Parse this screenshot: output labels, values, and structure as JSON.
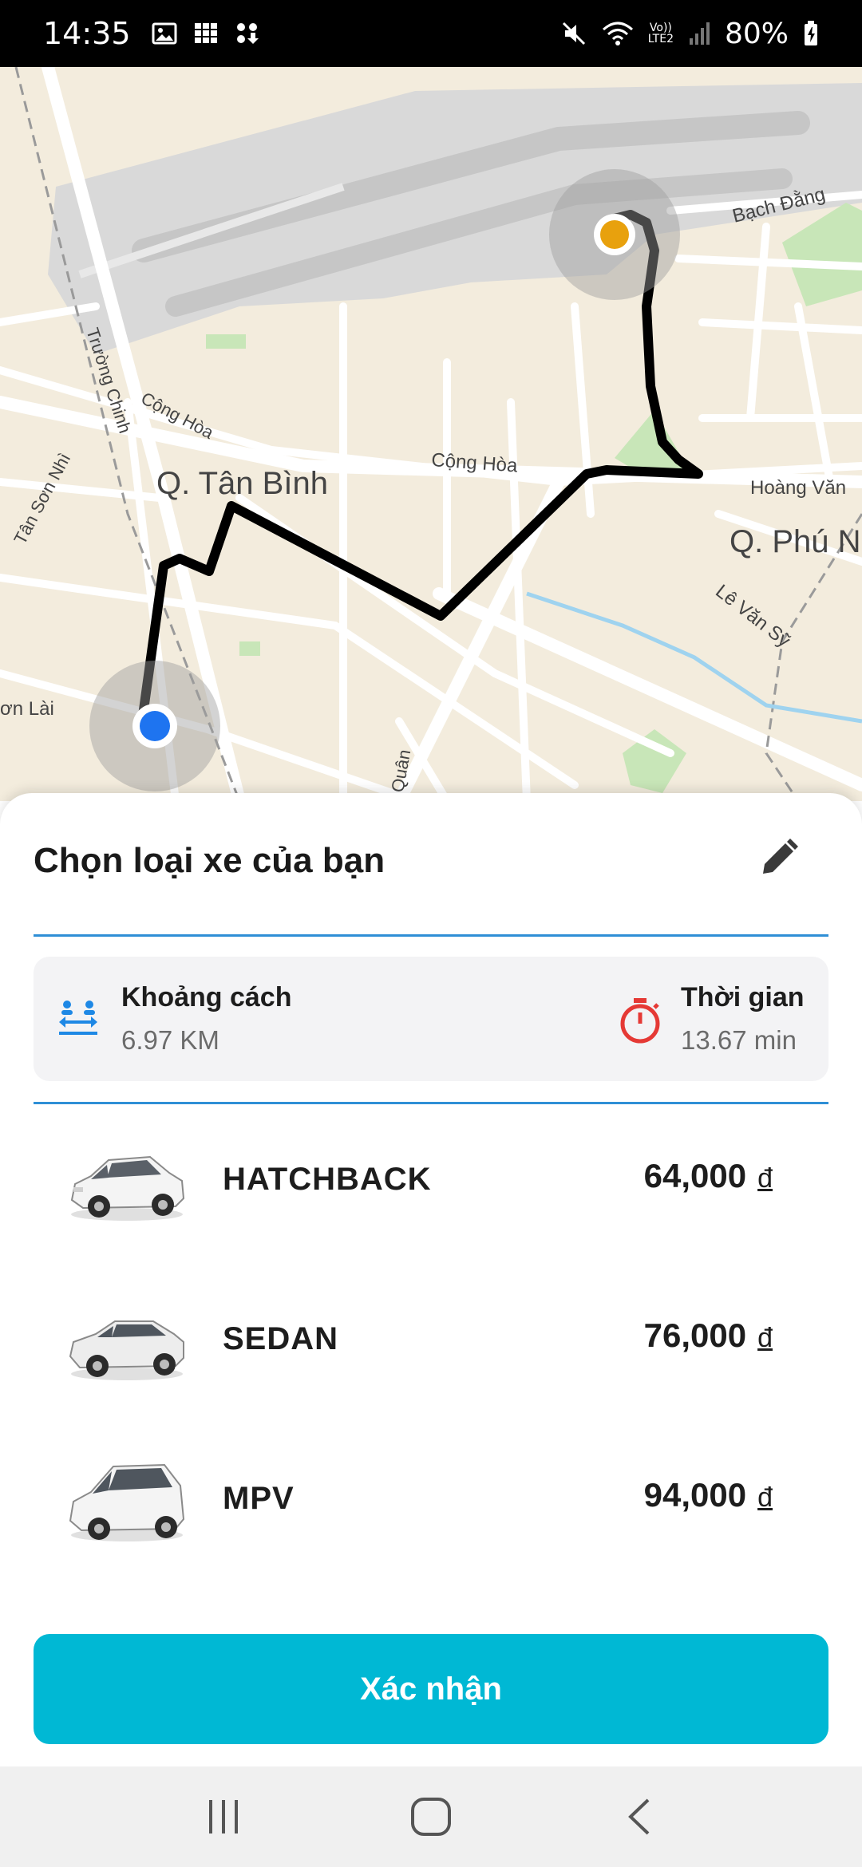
{
  "status_bar": {
    "time": "14:35",
    "battery": "80%",
    "network_top": "Vo))",
    "network_bottom": "LTE2",
    "icons": [
      "image-icon",
      "grid-icon",
      "download-icon",
      "mute-icon",
      "wifi-icon",
      "signal-icon",
      "battery-icon"
    ]
  },
  "map": {
    "labels": {
      "district_1": "Q. Tân Bình",
      "district_2": "Q. Phú N",
      "street_1": "Bạch Đằng",
      "street_2": "Cộng Hòa",
      "street_3": "Cộng Hòa",
      "street_4": "Hoàng Văn",
      "street_5": "Trường Chinh",
      "street_6": "Tân Sơn Nhì",
      "street_7": "Lê Văn Sỹ",
      "street_8": "ơn Lài",
      "street_9": "Quân"
    },
    "origin_color": "#1e74f0",
    "destination_color": "#e8a10d",
    "route_color": "#000000"
  },
  "sheet": {
    "title": "Chọn loại xe của bạn",
    "edit_icon": "pencil-icon",
    "distance_label": "Khoảng cách",
    "distance_value": "6.97 KM",
    "time_label": "Thời gian",
    "time_value": "13.67 min",
    "accent_color": "#2f8fd6",
    "timer_color": "#e53935"
  },
  "vehicles": [
    {
      "name": "HATCHBACK",
      "price": "64,000",
      "currency": "đ"
    },
    {
      "name": "SEDAN",
      "price": "76,000",
      "currency": "đ"
    },
    {
      "name": "MPV",
      "price": "94,000",
      "currency": "đ"
    }
  ],
  "confirm_label": "Xác nhận",
  "confirm_color": "#00b8d4",
  "nav": [
    "recent-apps-icon",
    "home-icon",
    "back-icon"
  ]
}
